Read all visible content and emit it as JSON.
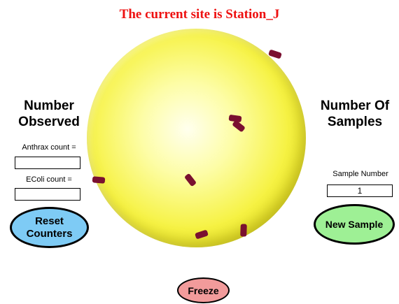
{
  "title": "The current site is Station_J",
  "left_panel": {
    "heading_line1": "Number",
    "heading_line2": "Observed",
    "anthrax_label": "Anthrax count =",
    "anthrax_value": "",
    "ecoli_label": "EColi count =",
    "ecoli_value": "",
    "reset_label_line1": "Reset",
    "reset_label_line2": "Counters"
  },
  "right_panel": {
    "heading_line1": "Number Of",
    "heading_line2": "Samples",
    "sample_number_label": "Sample Number",
    "sample_number_value": "1",
    "new_sample_label": "New Sample"
  },
  "freeze_label": "Freeze",
  "colors": {
    "title": "#ee1111",
    "germ": "#7a1030",
    "reset_button": "#7ecbf5",
    "new_sample_button": "#9ef095",
    "freeze_button": "#f29b9b"
  }
}
